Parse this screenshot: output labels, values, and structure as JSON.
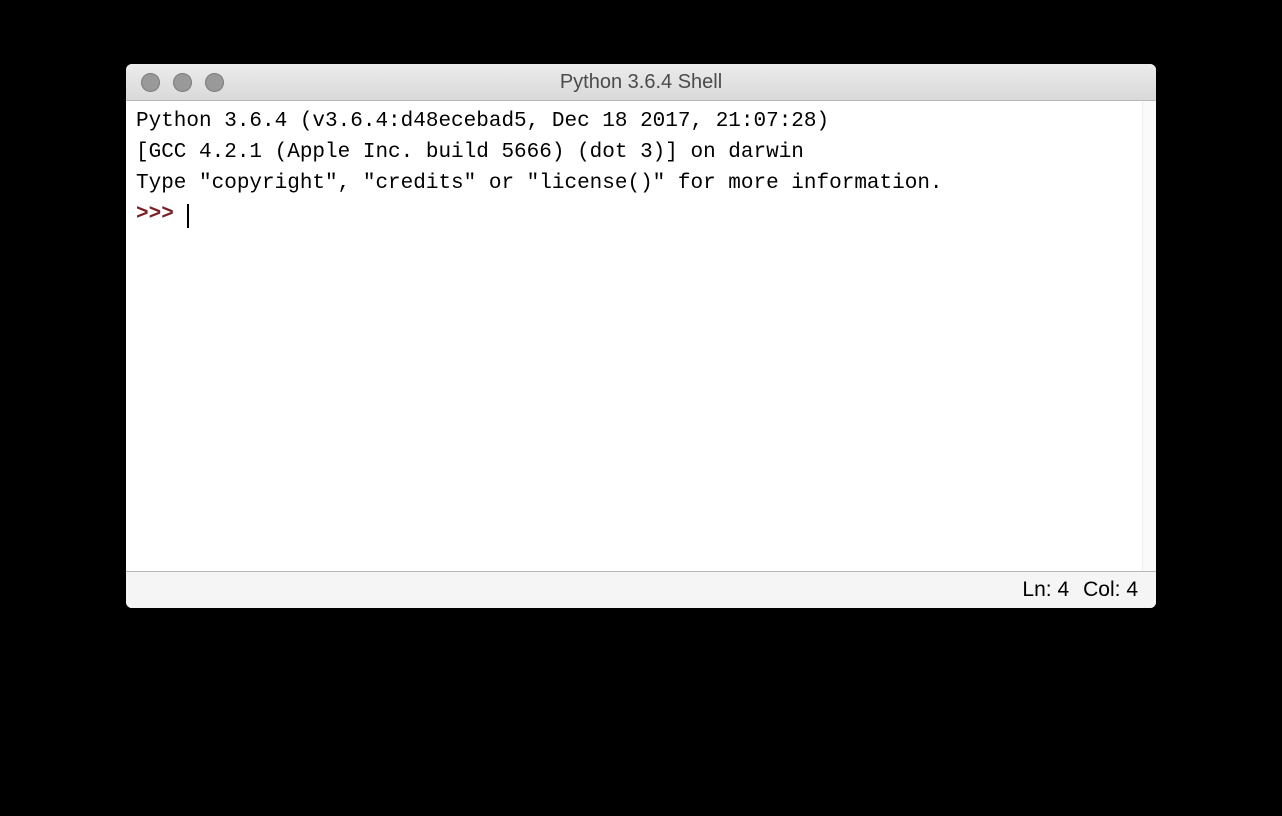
{
  "window": {
    "title": "Python 3.6.4 Shell"
  },
  "shell": {
    "line1": "Python 3.6.4 (v3.6.4:d48ecebad5, Dec 18 2017, 21:07:28) ",
    "line2": "[GCC 4.2.1 (Apple Inc. build 5666) (dot 3)] on darwin",
    "line3": "Type \"copyright\", \"credits\" or \"license()\" for more information.",
    "prompt": ">>> "
  },
  "status": {
    "line_label": "Ln: 4",
    "col_label": "Col: 4"
  }
}
